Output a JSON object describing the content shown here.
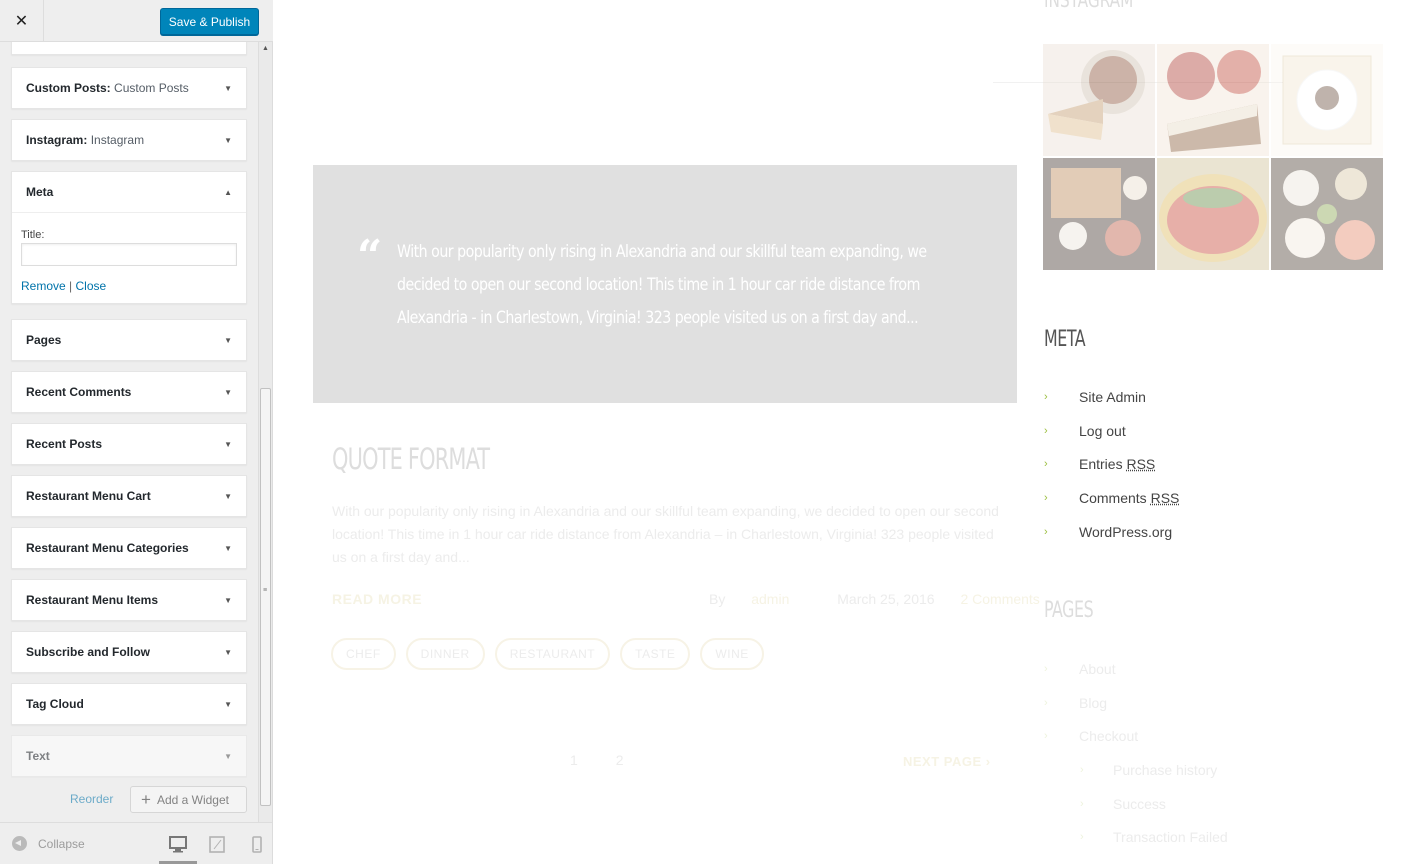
{
  "customizer": {
    "close_label": "✕",
    "publish_label": "Save & Publish",
    "widgets": [
      {
        "title": "Custom Posts:",
        "subtitle": "Custom Posts"
      },
      {
        "title": "Instagram:",
        "subtitle": "Instagram"
      },
      {
        "title": "Meta",
        "subtitle": ""
      },
      {
        "title": "Pages",
        "subtitle": ""
      },
      {
        "title": "Recent Comments",
        "subtitle": ""
      },
      {
        "title": "Recent Posts",
        "subtitle": ""
      },
      {
        "title": "Restaurant Menu Cart",
        "subtitle": ""
      },
      {
        "title": "Restaurant Menu Categories",
        "subtitle": ""
      },
      {
        "title": "Restaurant Menu Items",
        "subtitle": ""
      },
      {
        "title": "Subscribe and Follow",
        "subtitle": ""
      },
      {
        "title": "Tag Cloud",
        "subtitle": ""
      },
      {
        "title": "Text",
        "subtitle": ""
      }
    ],
    "meta_form": {
      "title_label": "Title:",
      "title_value": "",
      "remove_label": "Remove",
      "separator": "|",
      "close_label": "Close"
    },
    "reorder_label": "Reorder",
    "add_widget_label": "Add a Widget",
    "collapse_label": "Collapse",
    "accent_color": "#0085ba"
  },
  "preview": {
    "quote_mark": "“",
    "quote_text": "With our popularity only rising in Alexandria and our skillful team expanding, we decided to open our second location! This time in 1 hour car ride distance from Alexandria - in Charlestown, Virginia! 323 people visited us on a first day and...",
    "post_title": "QUOTE FORMAT",
    "post_excerpt": "With our popularity only rising in Alexandria and our skillful team expanding, we decided to open our second location! This time in 1 hour car ride distance from Alexandria – in Charlestown, Virginia! 323 people visited us on a first day and...",
    "read_more": "READ MORE",
    "by_label": "By",
    "author": "admin",
    "date": "March 25, 2016",
    "comments": "2 Comments",
    "tags": [
      "CHEF",
      "DINNER",
      "RESTAURANT",
      "TASTE",
      "WINE"
    ],
    "pages": [
      "1",
      "2"
    ],
    "next_page": "NEXT PAGE",
    "instagram_heading": "INSTAGRAM",
    "meta_heading": "META",
    "meta_links": [
      {
        "text": "Site Admin",
        "abbr": ""
      },
      {
        "text": "Log out",
        "abbr": ""
      },
      {
        "text": "Entries",
        "abbr": "RSS"
      },
      {
        "text": "Comments",
        "abbr": "RSS"
      },
      {
        "text": "WordPress.org",
        "abbr": ""
      }
    ],
    "pages_heading": "PAGES",
    "page_links": [
      {
        "text": "About",
        "sub": false
      },
      {
        "text": "Blog",
        "sub": false
      },
      {
        "text": "Checkout",
        "sub": false
      },
      {
        "text": "Purchase history",
        "sub": true
      },
      {
        "text": "Success",
        "sub": true
      },
      {
        "text": "Transaction Failed",
        "sub": true
      }
    ],
    "link_accent": "#9cbf40"
  }
}
